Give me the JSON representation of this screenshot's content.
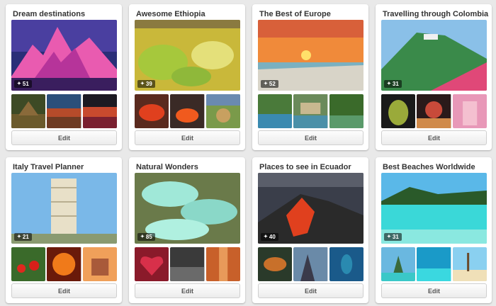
{
  "boards": [
    {
      "title": "Dream destinations",
      "pins": "51",
      "edit_label": "Edit"
    },
    {
      "title": "Awesome Ethiopia",
      "pins": "39",
      "edit_label": "Edit"
    },
    {
      "title": "The Best of Europe",
      "pins": "52",
      "edit_label": "Edit"
    },
    {
      "title": "Travelling through Colombia",
      "pins": "31",
      "edit_label": "Edit"
    },
    {
      "title": "Italy Travel Planner",
      "pins": "21",
      "edit_label": "Edit"
    },
    {
      "title": "Natural Wonders",
      "pins": "85",
      "edit_label": "Edit"
    },
    {
      "title": "Places to see in Ecuador",
      "pins": "40",
      "edit_label": "Edit"
    },
    {
      "title": "Best Beaches Worldwide",
      "pins": "31",
      "edit_label": "Edit"
    }
  ],
  "icons": {
    "pin": "pushpin-icon"
  }
}
